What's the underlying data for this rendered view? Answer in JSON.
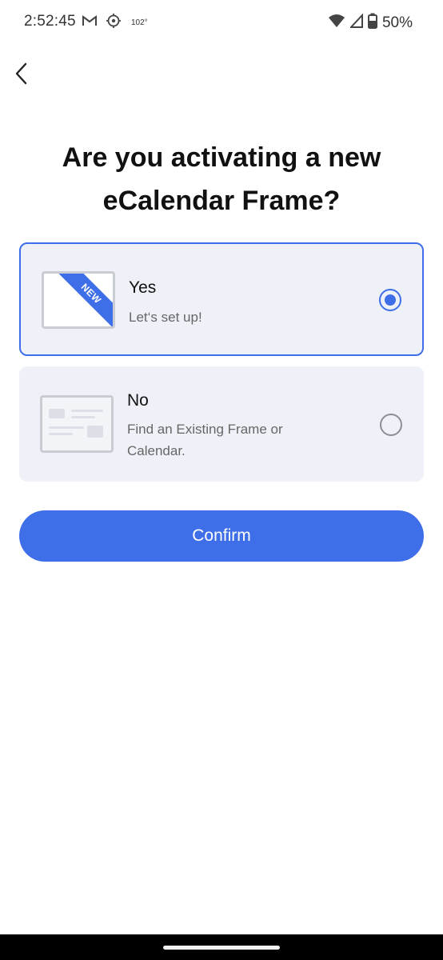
{
  "status_bar": {
    "time": "2:52:45",
    "temperature": "102°",
    "battery": "50%",
    "icons": [
      "gmail-icon",
      "location-icon",
      "wifi-icon",
      "cell-signal-icon",
      "battery-icon"
    ]
  },
  "header": {
    "back_icon": "chevron-left-icon",
    "title": "Are you activating a new eCalendar Frame?"
  },
  "options": [
    {
      "title": "Yes",
      "subtitle": "Let‘s set up!",
      "badge": "NEW",
      "selected": true
    },
    {
      "title": "No",
      "subtitle": "Find an Existing Frame or Calendar.",
      "selected": false
    }
  ],
  "confirm_label": "Confirm",
  "colors": {
    "accent": "#3f6fe8",
    "card_background": "#eef1f7",
    "nav_bar": "#000000"
  }
}
